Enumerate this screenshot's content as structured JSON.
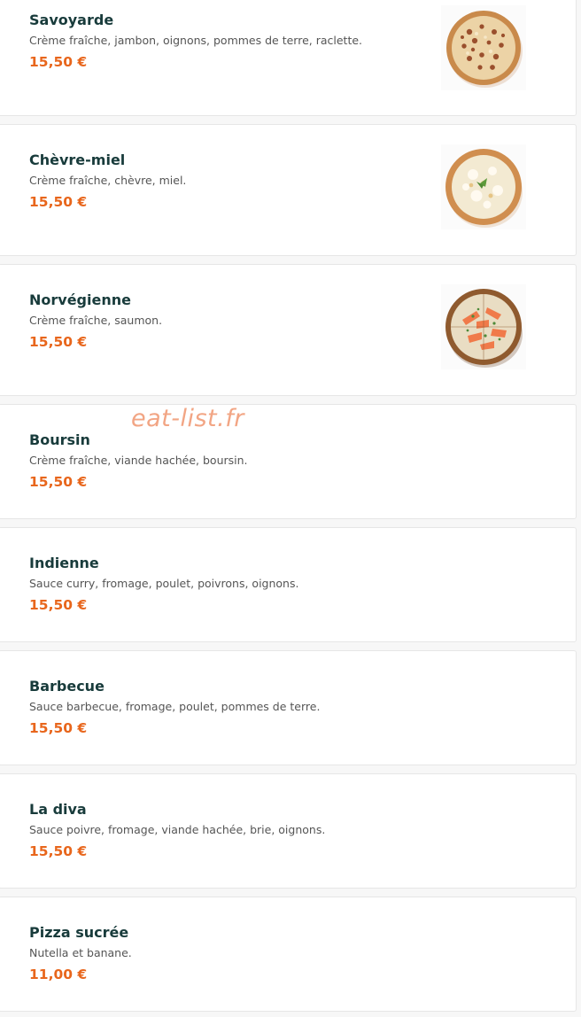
{
  "menu": {
    "items": [
      {
        "name": "Savoyarde",
        "description": "Crème fraîche, jambon, oignons, pommes de terre, raclette.",
        "price": "15,50 €",
        "photo": "savoyarde-pizza-photo"
      },
      {
        "name": "Chèvre-miel",
        "description": "Crème fraîche, chèvre, miel.",
        "price": "15,50 €",
        "photo": "chevre-miel-pizza-photo"
      },
      {
        "name": "Norvégienne",
        "description": "Crème fraîche, saumon.",
        "price": "15,50 €",
        "photo": "norvegienne-pizza-photo"
      },
      {
        "name": "Boursin",
        "description": "Crème fraîche, viande hachée, boursin.",
        "price": "15,50 €"
      },
      {
        "name": "Indienne",
        "description": "Sauce curry, fromage, poulet, poivrons, oignons.",
        "price": "15,50 €"
      },
      {
        "name": "Barbecue",
        "description": "Sauce barbecue, fromage, poulet, pommes de terre.",
        "price": "15,50 €"
      },
      {
        "name": "La diva",
        "description": "Sauce poivre, fromage, viande hachée, brie, oignons.",
        "price": "15,50 €"
      },
      {
        "name": "Pizza sucrée",
        "description": "Nutella et banane.",
        "price": "11,00 €"
      }
    ]
  },
  "watermark": {
    "text": "eat-list.fr"
  },
  "colors": {
    "name": "#183b3b",
    "description": "#555555",
    "price": "#e8661c",
    "watermark": "#f2a584",
    "card_background": "#ffffff",
    "card_border": "#e6e6e6"
  }
}
